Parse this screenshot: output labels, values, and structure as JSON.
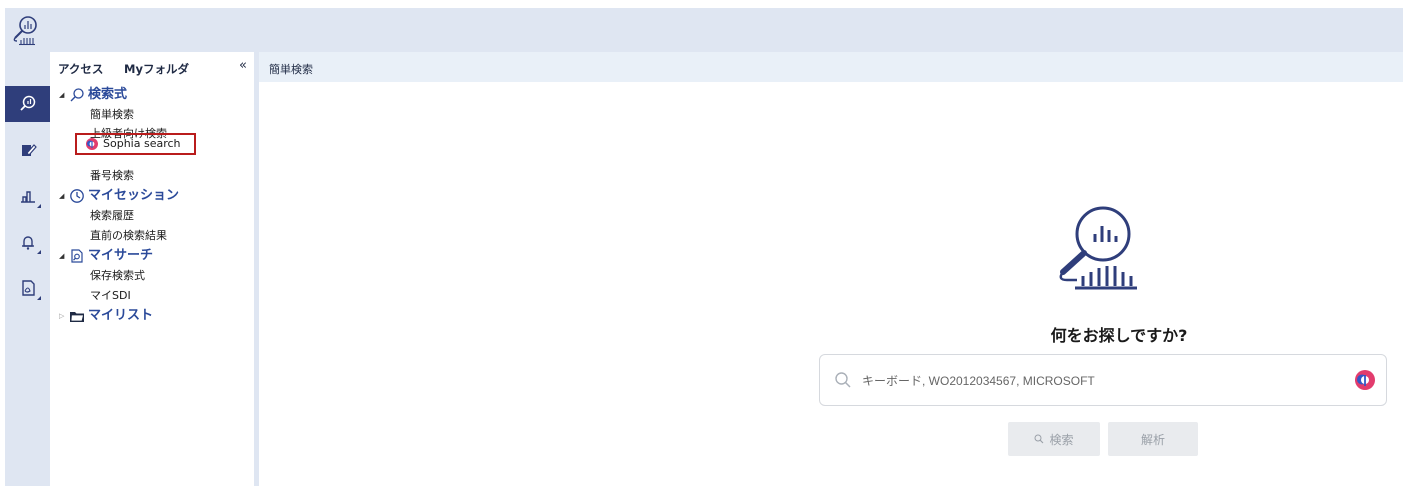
{
  "panel": {
    "tabs": [
      "アクセス",
      "Myフォルダ"
    ],
    "collapse_glyph": "«"
  },
  "tree": {
    "groups": [
      {
        "label": "検索式",
        "icon": "search-icon",
        "expanded": true,
        "children": [
          "簡単検索",
          "上級者向け検索",
          "Sophia search",
          "番号検索"
        ]
      },
      {
        "label": "マイセッション",
        "icon": "clock-icon",
        "expanded": true,
        "children": [
          "検索履歴",
          "直前の検索結果"
        ]
      },
      {
        "label": "マイサーチ",
        "icon": "saved-search-icon",
        "expanded": true,
        "children": [
          "保存検索式",
          "マイSDI"
        ]
      },
      {
        "label": "マイリスト",
        "icon": "folder-icon",
        "expanded": false,
        "children": []
      }
    ],
    "highlighted_item": "Sophia search"
  },
  "main": {
    "tab_label": "簡単検索",
    "question": "何をお探しですか?",
    "search_placeholder": "キーボード, WO2012034567, MICROSOFT",
    "search_button": "検索",
    "analyze_button": "解析"
  },
  "rail": {
    "items": [
      "search-icon",
      "edit-icon",
      "chart-icon",
      "bell-icon",
      "document-icon"
    ],
    "active": "search-icon"
  },
  "colors": {
    "topbar": "#dfe6f2",
    "rail_active": "#2f3e7b",
    "group_label": "#2b4a9a",
    "highlight_border": "#b91c1c"
  }
}
